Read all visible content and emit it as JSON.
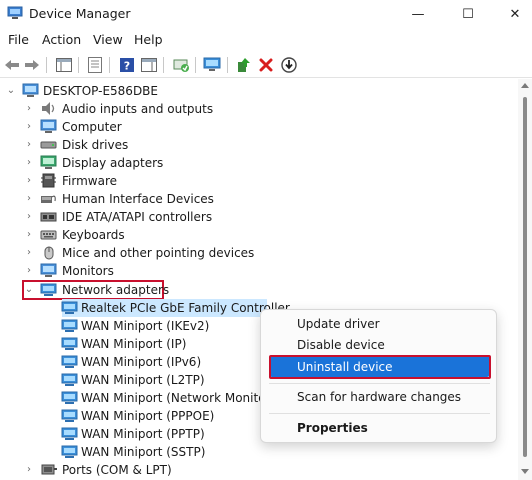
{
  "window": {
    "title": "Device Manager",
    "minimize_glyph": "—",
    "maximize_glyph": "☐",
    "close_glyph": "✕"
  },
  "menu": [
    "File",
    "Action",
    "View",
    "Help"
  ],
  "tree": {
    "root": "DESKTOP-E586DBE",
    "categories": [
      "Audio inputs and outputs",
      "Computer",
      "Disk drives",
      "Display adapters",
      "Firmware",
      "Human Interface Devices",
      "IDE ATA/ATAPI controllers",
      "Keyboards",
      "Mice and other pointing devices",
      "Monitors",
      "Network adapters"
    ],
    "network_adapters": [
      "Realtek PCIe GbE Family Controller",
      "WAN Miniport (IKEv2)",
      "WAN Miniport (IP)",
      "WAN Miniport (IPv6)",
      "WAN Miniport (L2TP)",
      "WAN Miniport (Network Monitor)",
      "WAN Miniport (PPPOE)",
      "WAN Miniport (PPTP)",
      "WAN Miniport (SSTP)"
    ],
    "after": "Ports (COM & LPT)"
  },
  "context_menu": {
    "update": "Update driver",
    "disable": "Disable device",
    "uninstall": "Uninstall device",
    "scan": "Scan for hardware changes",
    "properties": "Properties"
  },
  "colors": {
    "selection": "#cce8ff",
    "menu_highlight": "#1a73d9",
    "annotation_red": "#c8102e"
  }
}
